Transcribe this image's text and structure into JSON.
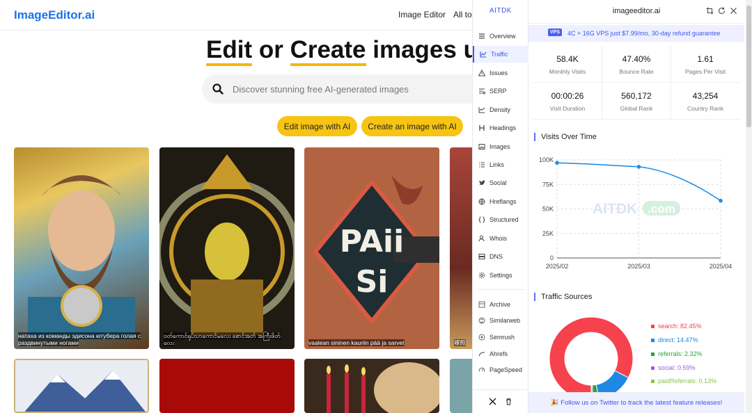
{
  "site": {
    "logo": "ImageEditor.ai",
    "nav": [
      "Image Editor",
      "All to"
    ],
    "hero_part1": "Edit",
    "hero_part2": " or ",
    "hero_part3": "Create",
    "hero_part4": " images us",
    "search_placeholder": "Discover stunning free AI-generated images",
    "btn_edit": "Edit image with AI",
    "btn_create": "Create an image with AI",
    "captions": [
      "натаха из команды эдисона ютубера голая с раздвинутыми ногами",
      "ဝတ်ကောင်ရုပ်သာကောင်မလေး စောင်အတ် အကြီးဖိတ် လေး",
      "vaalean sininen kauriin pää ja sarvet",
      "裸照"
    ],
    "card_texts": [
      "PAii",
      "Si"
    ]
  },
  "ext": {
    "brand": "AITDK",
    "nav": [
      "Overview",
      "Traffic",
      "Issues",
      "SERP",
      "Density",
      "Headings",
      "Images",
      "Links",
      "Social",
      "Hreflangs",
      "Structured",
      "Whois",
      "DNS",
      "Settings"
    ],
    "active": "Traffic",
    "tools": [
      "Archive",
      "Similarweb",
      "Semrush",
      "Ahrefs",
      "PageSpeed"
    ]
  },
  "panel": {
    "domain": "imageeditor.ai",
    "promo_badge": "VPS",
    "promo_text": "4C + 16G VPS just $7.99/mo, 30-day refund guarantee",
    "stats": [
      {
        "value": "58.4K",
        "label": "Monthly Visits"
      },
      {
        "value": "47.40%",
        "label": "Bounce Rate"
      },
      {
        "value": "1.61",
        "label": "Pages Per Visit"
      },
      {
        "value": "00:00:26",
        "label": "Visit Duration"
      },
      {
        "value": "560,172",
        "label": "Global Rank"
      },
      {
        "value": "43,254",
        "label": "Country Rank"
      }
    ],
    "visits_title": "Visits Over Time",
    "sources_title": "Traffic Sources",
    "watermark": "AITDK",
    "watermark_tld": ".com",
    "footer": "🎉 Follow us on Twitter to track the latest feature releases!"
  },
  "chart_data": [
    {
      "type": "line",
      "title": "Visits Over Time",
      "x": [
        "2025/02",
        "2025/03",
        "2025/04"
      ],
      "series": [
        {
          "values": [
            97000,
            93000,
            58400
          ]
        }
      ],
      "y_ticks": [
        "0",
        "25K",
        "50K",
        "75K",
        "100K"
      ],
      "ylim": [
        0,
        100000
      ],
      "grid": true,
      "color": "#1e90e8"
    },
    {
      "type": "pie",
      "title": "Traffic Sources",
      "donut": true,
      "legend_position": "right",
      "series": [
        {
          "name": "search",
          "label": "search: 82.45%",
          "value": 82.45,
          "color": "#f5424d"
        },
        {
          "name": "direct",
          "label": "direct: 14.47%",
          "value": 14.47,
          "color": "#1e88e5"
        },
        {
          "name": "referrals",
          "label": "referrals: 2.32%",
          "value": 2.32,
          "color": "#2e9e3a"
        },
        {
          "name": "social",
          "label": "social: 0.59%",
          "value": 0.59,
          "color": "#a259e6"
        },
        {
          "name": "paidReferrals",
          "label": "paidReferrals: 0.13%",
          "value": 0.13,
          "color": "#8bc34a"
        }
      ]
    }
  ]
}
